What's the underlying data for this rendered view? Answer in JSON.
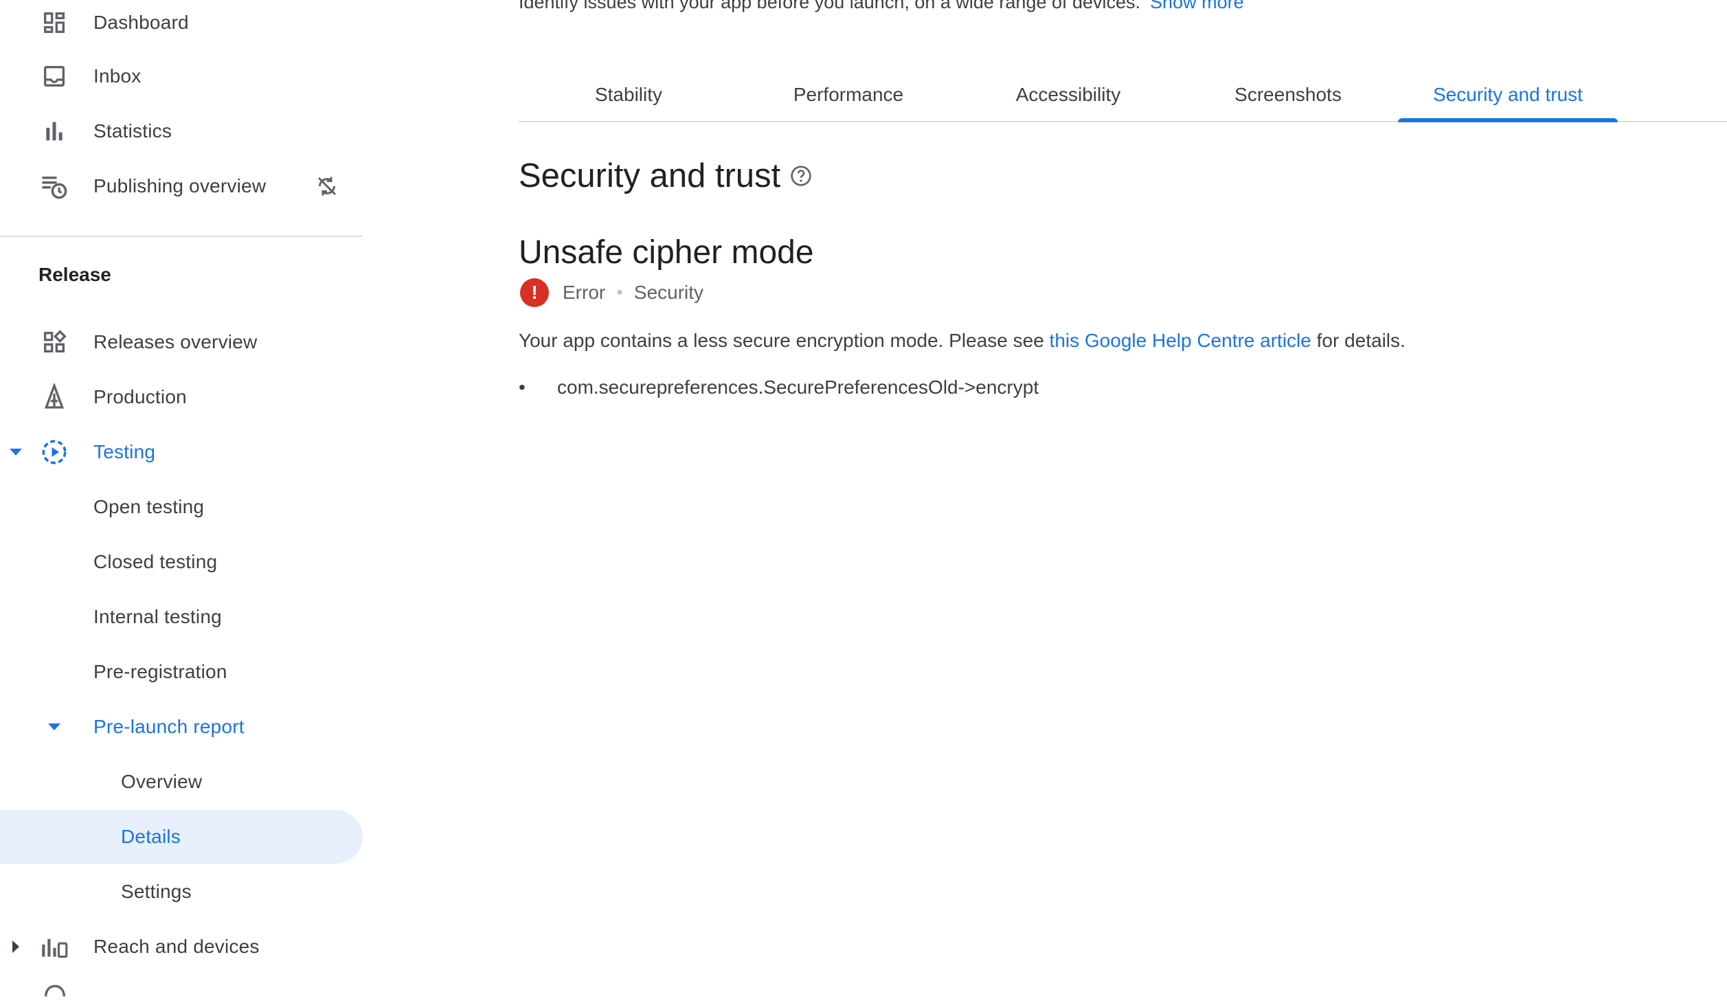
{
  "sidebar": {
    "items": [
      {
        "label": "Dashboard",
        "icon": "dashboard-icon"
      },
      {
        "label": "Inbox",
        "icon": "inbox-icon"
      },
      {
        "label": "Statistics",
        "icon": "statistics-icon"
      },
      {
        "label": "Publishing overview",
        "icon": "publishing-overview-icon"
      }
    ],
    "section_title": "Release",
    "release_items": [
      {
        "label": "Releases overview",
        "icon": "releases-overview-icon"
      },
      {
        "label": "Production",
        "icon": "production-icon"
      },
      {
        "label": "Testing",
        "icon": "testing-icon"
      },
      {
        "label": "Open testing"
      },
      {
        "label": "Closed testing"
      },
      {
        "label": "Internal testing"
      },
      {
        "label": "Pre-registration"
      },
      {
        "label": "Pre-launch report"
      },
      {
        "label": "Overview"
      },
      {
        "label": "Details"
      },
      {
        "label": "Settings"
      },
      {
        "label": "Reach and devices",
        "icon": "reach-devices-icon"
      }
    ]
  },
  "main": {
    "intro_text": "Identify issues with your app before you launch, on a wide range of devices.",
    "show_more": "Show more",
    "tabs": [
      {
        "label": "Stability"
      },
      {
        "label": "Performance"
      },
      {
        "label": "Accessibility"
      },
      {
        "label": "Screenshots"
      },
      {
        "label": "Security and trust"
      }
    ],
    "active_tab": "Security and trust",
    "heading": "Security and trust",
    "issue_title": "Unsafe cipher mode",
    "severity": "Error",
    "category": "Security",
    "description_prefix": "Your app contains a less secure encryption mode. Please see ",
    "description_link": "this Google Help Centre article",
    "description_suffix": " for details.",
    "findings": [
      "com.securepreferences.SecurePreferencesOld->encrypt"
    ]
  },
  "colors": {
    "accent": "#1a73e8",
    "error": "#d93025",
    "selected_bg": "#e8f0fe"
  }
}
